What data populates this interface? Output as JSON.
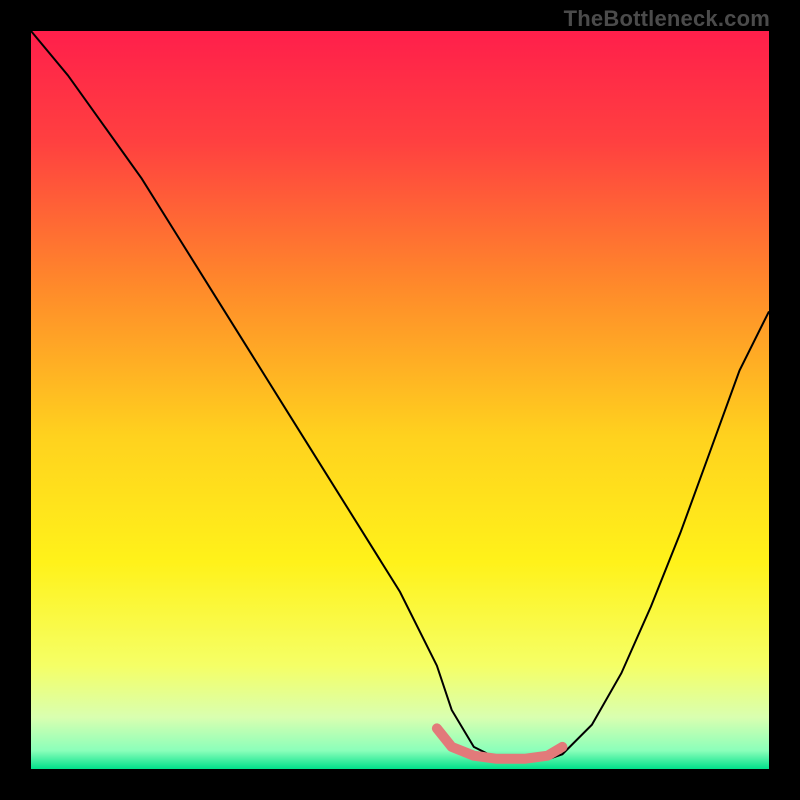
{
  "watermark": "TheBottleneck.com",
  "chart_data": {
    "type": "line",
    "title": "",
    "xlabel": "",
    "ylabel": "",
    "xlim": [
      0,
      100
    ],
    "ylim": [
      0,
      100
    ],
    "grid": false,
    "legend": false,
    "background_gradient": {
      "stops": [
        {
          "pos": 0.0,
          "color": "#ff1f4b"
        },
        {
          "pos": 0.15,
          "color": "#ff4040"
        },
        {
          "pos": 0.35,
          "color": "#ff8b2a"
        },
        {
          "pos": 0.55,
          "color": "#ffd21e"
        },
        {
          "pos": 0.72,
          "color": "#fff21a"
        },
        {
          "pos": 0.86,
          "color": "#f5ff66"
        },
        {
          "pos": 0.93,
          "color": "#d9ffb0"
        },
        {
          "pos": 0.975,
          "color": "#8bffba"
        },
        {
          "pos": 1.0,
          "color": "#00e08a"
        }
      ]
    },
    "series": [
      {
        "name": "bottleneck-curve",
        "stroke": "#000000",
        "stroke_width": 2,
        "x": [
          0,
          5,
          10,
          15,
          20,
          25,
          30,
          35,
          40,
          45,
          50,
          55,
          57,
          60,
          63,
          67,
          70,
          72,
          76,
          80,
          84,
          88,
          92,
          96,
          100
        ],
        "values": [
          100,
          94,
          87,
          80,
          72,
          64,
          56,
          48,
          40,
          32,
          24,
          14,
          8,
          3,
          1.5,
          1.2,
          1.3,
          2,
          6,
          13,
          22,
          32,
          43,
          54,
          62
        ]
      },
      {
        "name": "optimal-band-marker",
        "stroke": "#e27a7a",
        "stroke_width": 10,
        "linecap": "round",
        "x": [
          55,
          57,
          60,
          63,
          67,
          70,
          72
        ],
        "values": [
          5.5,
          3,
          1.8,
          1.4,
          1.4,
          1.8,
          3
        ]
      }
    ]
  }
}
